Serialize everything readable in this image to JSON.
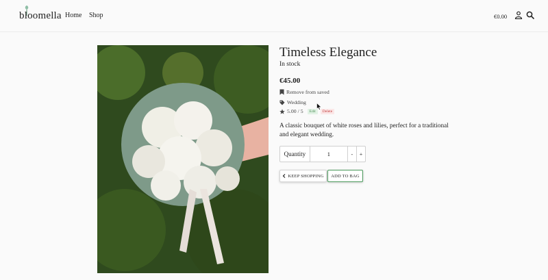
{
  "header": {
    "logo_text": "bloomella",
    "nav": [
      "Home",
      "Shop"
    ],
    "cart_total": "€0.00",
    "icons": [
      "user-icon",
      "search-icon"
    ]
  },
  "product": {
    "title": "Timeless Elegance",
    "stock": "In stock",
    "price": "€45.00",
    "saved_label": "Remove from saved",
    "category": "Wedding",
    "rating": "5.00 / 5",
    "edit_label": "Edit",
    "delete_label": "Delete",
    "description": "A classic bouquet of white roses and lilies, perfect for a traditional and elegant wedding.",
    "quantity_label": "Quantity",
    "quantity_value": "1",
    "decrement": "-",
    "increment": "+",
    "keep_shopping": "KEEP SHOPPING",
    "add_to_bag": "ADD TO BAG"
  },
  "colors": {
    "accent_green": "#4a9a5b",
    "delete_red": "#c23b3b"
  }
}
